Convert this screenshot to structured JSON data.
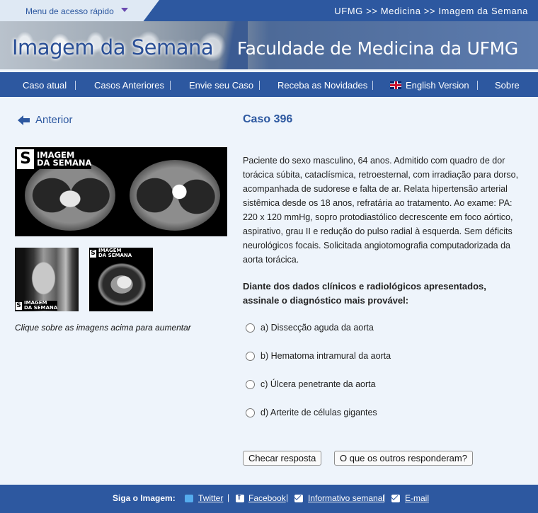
{
  "top": {
    "quick_menu_label": "Menu de acesso rápido",
    "breadcrumb": "UFMG >> Medicina >> Imagem da Semana"
  },
  "banner": {
    "title": "Imagem da Semana",
    "school": "Faculdade de Medicina da UFMG"
  },
  "nav": {
    "items": [
      "Caso atual",
      "Casos Anteriores",
      "Envie seu Caso",
      "Receba as Novidades",
      "English Version",
      "Sobre"
    ]
  },
  "left": {
    "back_label": "Anterior",
    "badge_line1": "IMAGEM",
    "badge_line2": "DA SEMANA",
    "badge_letter": "S",
    "click_hint": "Clique sobre as imagens acima para aumentar"
  },
  "case": {
    "title": "Caso 396",
    "description": "Paciente do sexo masculino, 64 anos. Admitido com quadro de dor torácica súbita, cataclísmica, retroesternal, com irradiação para dorso, acompanhada de sudorese e falta de ar. Relata hipertensão arterial sistêmica desde os 18 anos, refratária ao tratamento. Ao exame: PA: 220 x 120 mmHg, sopro protodiastólico decrescente em foco aórtico, aspirativo, grau II e redução do pulso radial à esquerda. Sem déficits neurológicos focais. Solicitada angiotomografia computadorizada da aorta torácica.",
    "question": "Diante dos dados clínicos e radiológicos apresentados, assinale o diagnóstico mais provável:",
    "options": [
      "a) Dissecção aguda da aorta",
      "b) Hematoma intramural da aorta",
      "c) Úlcera penetrante da aorta",
      "d) Arterite de células gigantes"
    ],
    "check_button": "Checar resposta",
    "others_button": "O que os outros responderam?"
  },
  "footer": {
    "follow_label": "Siga o Imagem:",
    "links": [
      "Twitter",
      "Facebook",
      "Informativo semanal",
      "E-mail"
    ]
  }
}
